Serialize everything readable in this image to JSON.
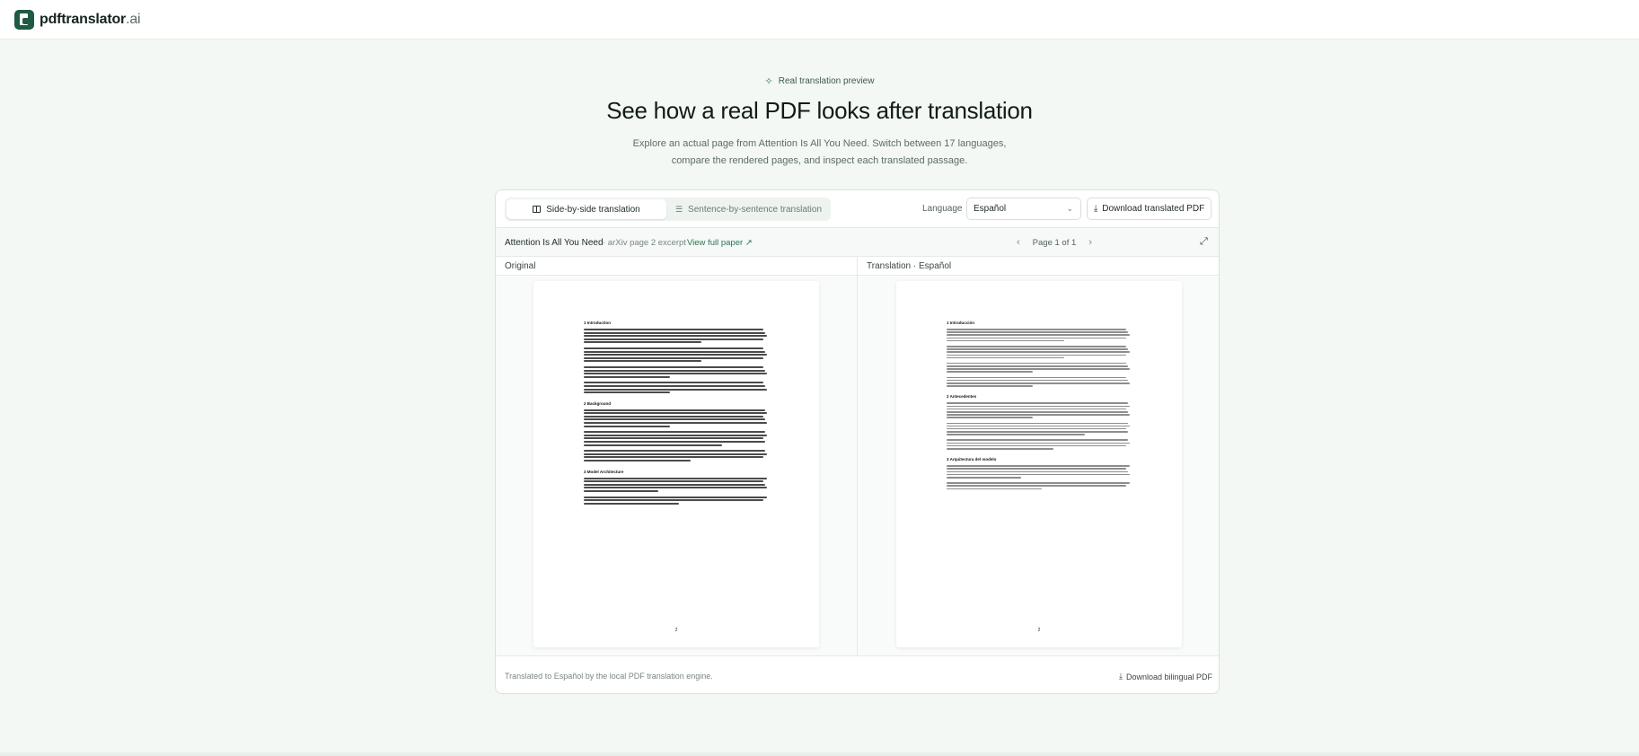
{
  "brand": {
    "name": "pdftranslator",
    "suffix": ".ai"
  },
  "hero": {
    "tag": "Real translation preview",
    "title": "See how a real PDF looks after translation",
    "subtitle_line1": "Explore an actual page from Attention Is All You Need. Switch between 17 languages,",
    "subtitle_line2": "compare the rendered pages, and inspect each translated passage."
  },
  "toolbar": {
    "modes": [
      {
        "label": "Side-by-side translation",
        "active": true
      },
      {
        "label": "Sentence-by-sentence translation",
        "active": false
      }
    ],
    "language_label": "Language",
    "language_value": "Español",
    "download_label": "Download translated PDF"
  },
  "doc": {
    "title": "Attention Is All You Need",
    "meta": "· arXiv page 2 excerpt",
    "view_link": "View full paper",
    "pager": "Page 1 of 1"
  },
  "panes": {
    "original_title": "Original",
    "translation_title": "Translation · Español",
    "page_number": "2"
  },
  "original_sections": [
    "1   Introduction",
    "2   Background",
    "3   Model Architecture"
  ],
  "translation_sections": [
    "1 Introducción",
    "2 Antecedentes",
    "3 Arquitectura del modelo"
  ],
  "footer": {
    "note": "Translated to Español by the local PDF translation engine.",
    "download_bilingual": "Download bilingual PDF"
  },
  "colors": {
    "accent": "#1f5a43",
    "link": "#2c7253",
    "background": "#f3f8f4"
  }
}
